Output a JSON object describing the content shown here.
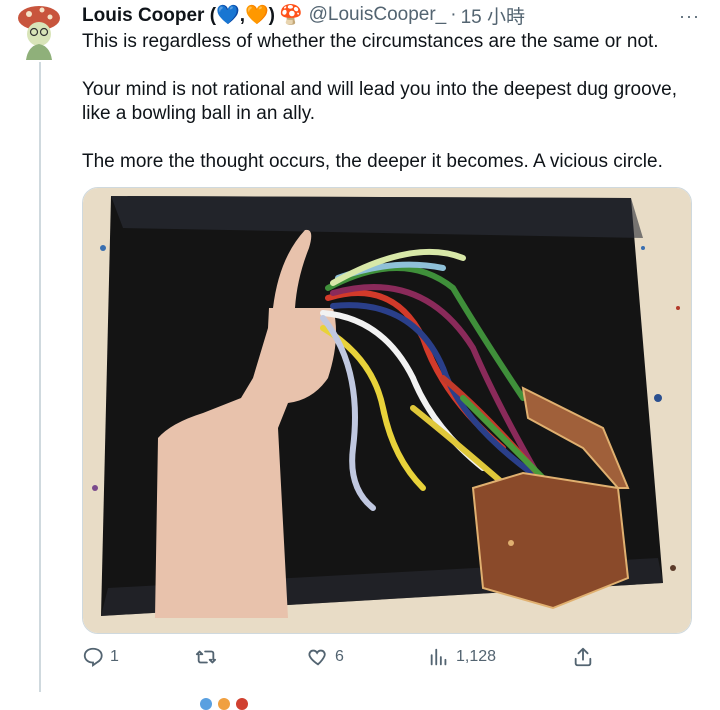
{
  "tweet": {
    "display_name": "Louis Cooper (💙,🧡)",
    "badge_emoji": "🍄",
    "handle": "@LouisCooper_",
    "separator": "·",
    "timestamp": "15 小時",
    "more_label": "···",
    "paragraphs": [
      "This is regardless of whether the circumstances are the same or not.",
      "Your mind is not rational and will lead you into the deepest dug groove, like a bowling ball in an ally.",
      "The more the thought occurs, the deeper it becomes. A vicious circle."
    ]
  },
  "actions": {
    "reply_count": "1",
    "retweet_count": "",
    "like_count": "6",
    "views_count": "1,128"
  },
  "icons": {
    "avatar": "mushroom-avatar",
    "reply": "reply-icon",
    "retweet": "retweet-icon",
    "like": "heart-icon",
    "views": "views-icon",
    "share": "share-icon"
  },
  "colors": {
    "text": "#0f1419",
    "muted": "#536471",
    "border": "#cfd9de"
  }
}
